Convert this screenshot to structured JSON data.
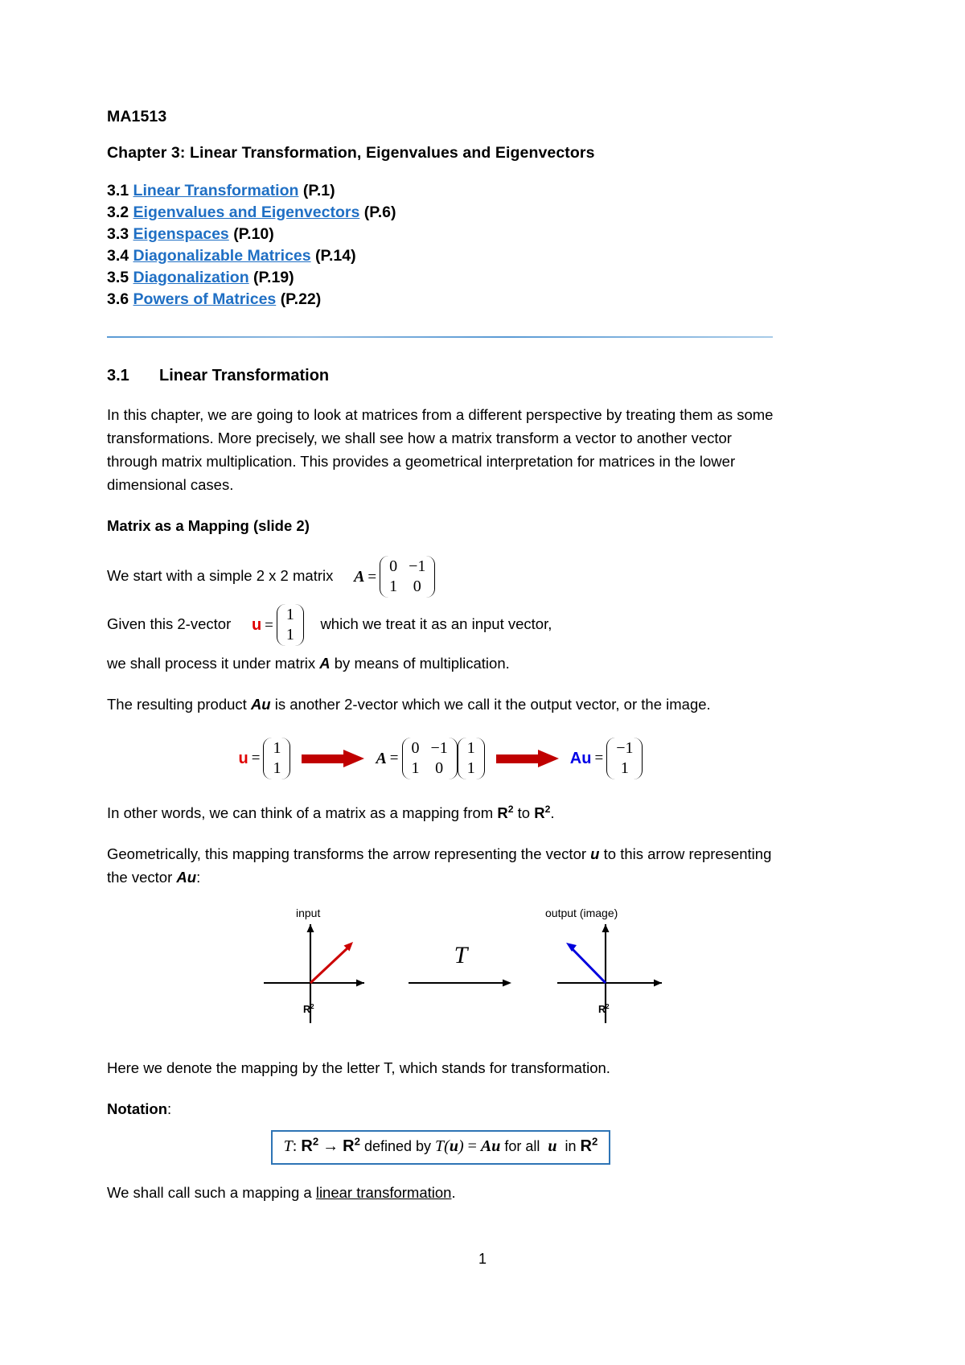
{
  "document": {
    "course_code": "MA1513",
    "chapter_title": "Chapter 3: Linear Transformation, Eigenvalues and Eigenvectors",
    "page_number": "1"
  },
  "toc": {
    "items": [
      {
        "num": "3.1",
        "label": "Linear Transformation",
        "page": "(P.1)"
      },
      {
        "num": "3.2",
        "label": "Eigenvalues and Eigenvectors",
        "page": "(P.6)"
      },
      {
        "num": "3.3",
        "label": "Eigenspaces",
        "page": "(P.10)"
      },
      {
        "num": "3.4",
        "label": "Diagonalizable Matrices",
        "page": "(P.14)"
      },
      {
        "num": "3.5",
        "label": "Diagonalization",
        "page": "(P.19)"
      },
      {
        "num": "3.6",
        "label": "Powers of Matrices",
        "page": "(P.22)"
      }
    ]
  },
  "section": {
    "number": "3.1",
    "title": "Linear Transformation",
    "intro": "In this chapter, we are going to look at matrices from a different perspective by treating them as some transformations. More precisely, we shall see how a matrix transform a vector to another vector through matrix multiplication. This provides a geometrical interpretation for matrices in the lower dimensional cases.",
    "subheading": "Matrix as a Mapping (slide 2)",
    "line_matrix_intro": "We start with a simple 2 x 2 matrix",
    "line_vector_intro": "Given this 2-vector",
    "line_vector_tail": "which we treat it as an input vector,",
    "line_process": "we shall process it under matrix",
    "line_process_tail": "by means of multiplication.",
    "line_result_pre": "The resulting product",
    "line_result_post": "is another 2-vector which we call it the output vector, or the image.",
    "line_mapping_pre": "In other words, we can think of a matrix as a mapping from",
    "line_mapping_mid": "to",
    "line_mapping_end": ".",
    "line_geom_1": "Geometrically, this mapping transforms the arrow representing the vector",
    "line_geom_2": "to this arrow representing the vector",
    "line_geom_3": ":",
    "line_denote": "Here we denote the mapping by the letter T, which stands for transformation.",
    "notation_label": "Notation",
    "notation_colon": ":",
    "closing_pre": "We shall call such a mapping a",
    "closing_underlined": "linear transformation",
    "closing_post": "."
  },
  "math": {
    "A_symbol": "A",
    "u_symbol": "u",
    "Au_symbol": "Au",
    "equals": "=",
    "matrix_A": [
      [
        "0",
        "−1"
      ],
      [
        "1",
        "0"
      ]
    ],
    "vector_u": [
      "1",
      "1"
    ],
    "vector_Au": [
      "−1",
      "1"
    ],
    "R2": "R",
    "exponent_2": "2"
  },
  "diagram": {
    "input_label": "input",
    "output_label": "output (image)",
    "transform_label": "T",
    "left_space_label": "R",
    "right_space_label": "R",
    "space_exponent": "2",
    "input_vector_color": "#cc0000",
    "output_vector_color": "#0000dd",
    "input_vector": [
      1,
      1
    ],
    "output_vector": [
      -1,
      1
    ]
  },
  "notation": {
    "T": "T",
    "colon": ":",
    "R": "R",
    "exp": "2",
    "arrow": "→",
    "defined_by": "defined by",
    "Tu": "T(",
    "u": "u",
    "close": ")",
    "eq": "=",
    "Au": "Au",
    "for_all": "for all",
    "in": "in"
  },
  "colors": {
    "link": "#1f6fc4",
    "rule": "#5b9bd5",
    "red_accent": "#c00000",
    "blue_accent": "#0000e6",
    "box_border": "#2e74b5"
  }
}
